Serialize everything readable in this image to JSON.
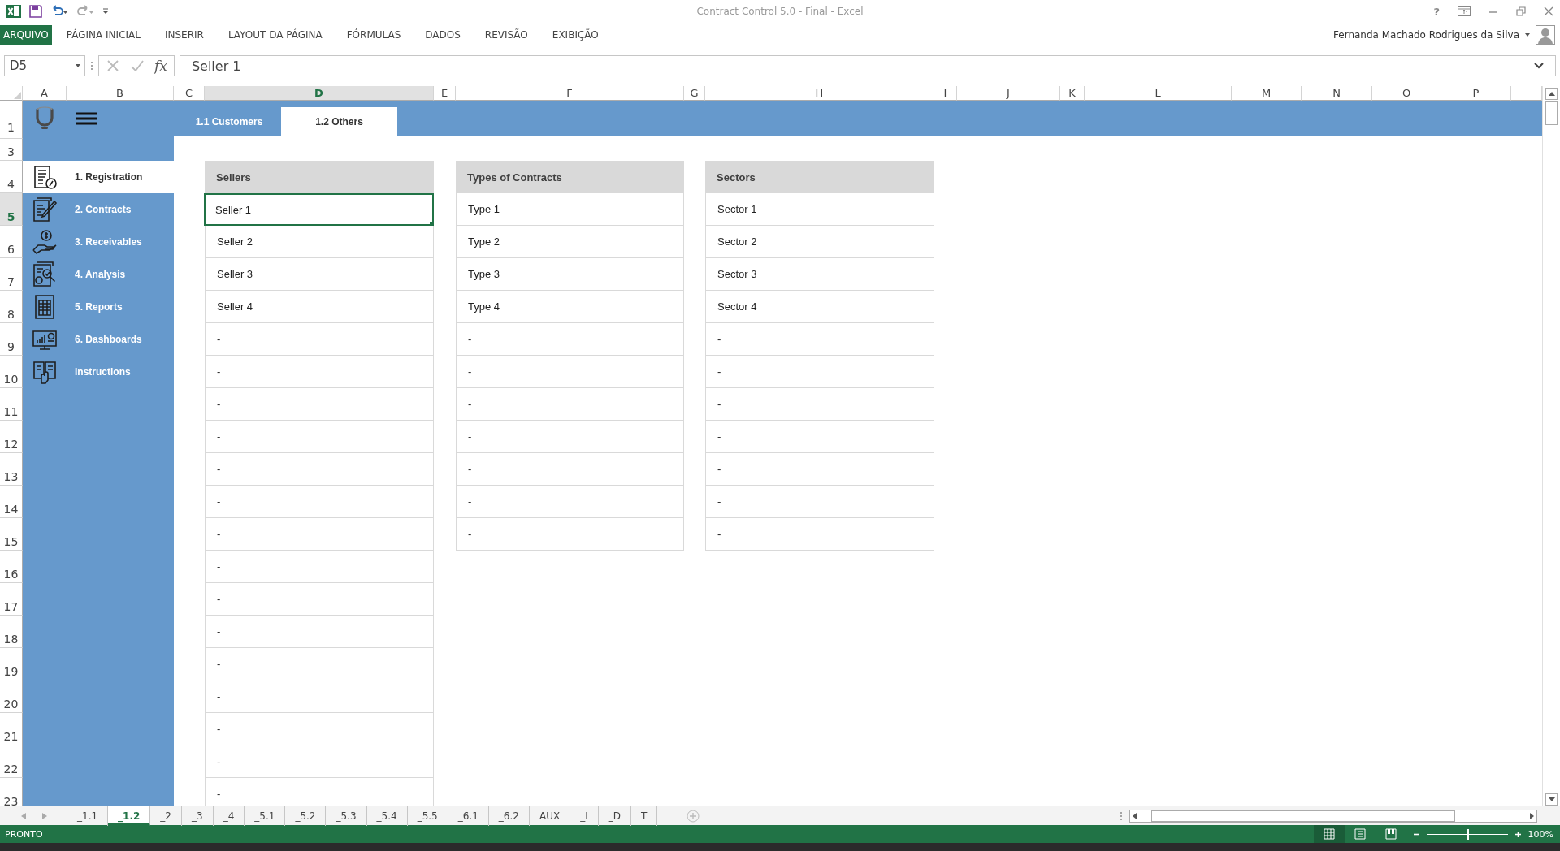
{
  "title_bar": {
    "title": "Contract Control 5.0 - Final - Excel",
    "help": "?"
  },
  "ribbon_tabs": [
    {
      "label": "ARQUIVO",
      "kind": "file"
    },
    {
      "label": "PÁGINA INICIAL",
      "kind": "tab"
    },
    {
      "label": "INSERIR",
      "kind": "tab"
    },
    {
      "label": "LAYOUT DA PÁGINA",
      "kind": "tab"
    },
    {
      "label": "FÓRMULAS",
      "kind": "tab"
    },
    {
      "label": "DADOS",
      "kind": "tab"
    },
    {
      "label": "REVISÃO",
      "kind": "tab"
    },
    {
      "label": "EXIBIÇÃO",
      "kind": "tab"
    }
  ],
  "user": {
    "name": "Fernanda Machado Rodrigues da Silva"
  },
  "formula_bar": {
    "name_box": "D5",
    "function_label": "fx",
    "value": "Seller 1"
  },
  "column_headers": [
    {
      "label": "A",
      "selected": false
    },
    {
      "label": "B",
      "selected": false
    },
    {
      "label": "C",
      "selected": false
    },
    {
      "label": "D",
      "selected": true
    },
    {
      "label": "E",
      "selected": false
    },
    {
      "label": "F",
      "selected": false
    },
    {
      "label": "G",
      "selected": false
    },
    {
      "label": "H",
      "selected": false
    },
    {
      "label": "I",
      "selected": false
    },
    {
      "label": "J",
      "selected": false
    },
    {
      "label": "K",
      "selected": false
    },
    {
      "label": "L",
      "selected": false
    },
    {
      "label": "M",
      "selected": false
    },
    {
      "label": "N",
      "selected": false
    },
    {
      "label": "O",
      "selected": false
    },
    {
      "label": "P",
      "selected": false
    }
  ],
  "row_headers": [
    {
      "label": "1",
      "selected": false
    },
    {
      "label": "3",
      "selected": false
    },
    {
      "label": "4",
      "selected": false
    },
    {
      "label": "5",
      "selected": true
    },
    {
      "label": "6",
      "selected": false
    },
    {
      "label": "7",
      "selected": false
    },
    {
      "label": "8",
      "selected": false
    },
    {
      "label": "9",
      "selected": false
    },
    {
      "label": "10",
      "selected": false
    },
    {
      "label": "11",
      "selected": false
    },
    {
      "label": "12",
      "selected": false
    },
    {
      "label": "13",
      "selected": false
    },
    {
      "label": "14",
      "selected": false
    },
    {
      "label": "15",
      "selected": false
    },
    {
      "label": "16",
      "selected": false
    },
    {
      "label": "17",
      "selected": false
    },
    {
      "label": "18",
      "selected": false
    },
    {
      "label": "19",
      "selected": false
    },
    {
      "label": "20",
      "selected": false
    },
    {
      "label": "21",
      "selected": false
    },
    {
      "label": "22",
      "selected": false
    },
    {
      "label": "23",
      "selected": false
    }
  ],
  "sidebar": {
    "items": [
      {
        "label": "1. Registration",
        "selected": true
      },
      {
        "label": "2. Contracts",
        "selected": false
      },
      {
        "label": "3. Receivables",
        "selected": false
      },
      {
        "label": "4. Analysis",
        "selected": false
      },
      {
        "label": "5. Reports",
        "selected": false
      },
      {
        "label": "6. Dashboards",
        "selected": false
      },
      {
        "label": "Instructions",
        "selected": false
      }
    ]
  },
  "page_tabs": [
    {
      "label": "1.1 Customers",
      "selected": false
    },
    {
      "label": "1.2 Others",
      "selected": true
    }
  ],
  "tables": [
    {
      "header": "Sellers",
      "rows": [
        {
          "text": "Seller 1",
          "selected": true
        },
        {
          "text": "Seller 2",
          "selected": false
        },
        {
          "text": "Seller 3",
          "selected": false
        },
        {
          "text": "Seller 4",
          "selected": false
        },
        {
          "text": "-",
          "selected": false
        },
        {
          "text": "-",
          "selected": false
        },
        {
          "text": "-",
          "selected": false
        },
        {
          "text": "-",
          "selected": false
        },
        {
          "text": "-",
          "selected": false
        },
        {
          "text": "-",
          "selected": false
        },
        {
          "text": "-",
          "selected": false
        },
        {
          "text": "-",
          "selected": false
        },
        {
          "text": "-",
          "selected": false
        },
        {
          "text": "-",
          "selected": false
        },
        {
          "text": "-",
          "selected": false
        },
        {
          "text": "-",
          "selected": false
        },
        {
          "text": "-",
          "selected": false
        },
        {
          "text": "-",
          "selected": false
        },
        {
          "text": "-",
          "selected": false
        }
      ]
    },
    {
      "header": "Types of Contracts",
      "rows": [
        {
          "text": "Type 1",
          "selected": false
        },
        {
          "text": "Type 2",
          "selected": false
        },
        {
          "text": "Type 3",
          "selected": false
        },
        {
          "text": "Type 4",
          "selected": false
        },
        {
          "text": "-",
          "selected": false
        },
        {
          "text": "-",
          "selected": false
        },
        {
          "text": "-",
          "selected": false
        },
        {
          "text": "-",
          "selected": false
        },
        {
          "text": "-",
          "selected": false
        },
        {
          "text": "-",
          "selected": false
        },
        {
          "text": "-",
          "selected": false
        }
      ]
    },
    {
      "header": "Sectors",
      "rows": [
        {
          "text": "Sector 1",
          "selected": false
        },
        {
          "text": "Sector 2",
          "selected": false
        },
        {
          "text": "Sector 3",
          "selected": false
        },
        {
          "text": "Sector 4",
          "selected": false
        },
        {
          "text": "-",
          "selected": false
        },
        {
          "text": "-",
          "selected": false
        },
        {
          "text": "-",
          "selected": false
        },
        {
          "text": "-",
          "selected": false
        },
        {
          "text": "-",
          "selected": false
        },
        {
          "text": "-",
          "selected": false
        },
        {
          "text": "-",
          "selected": false
        }
      ]
    }
  ],
  "sheet_tabs": [
    {
      "label": "_1.1",
      "selected": false
    },
    {
      "label": "_1.2",
      "selected": true
    },
    {
      "label": "_2",
      "selected": false
    },
    {
      "label": "_3",
      "selected": false
    },
    {
      "label": "_4",
      "selected": false
    },
    {
      "label": "_5.1",
      "selected": false
    },
    {
      "label": "_5.2",
      "selected": false
    },
    {
      "label": "_5.3",
      "selected": false
    },
    {
      "label": "_5.4",
      "selected": false
    },
    {
      "label": "_5.5",
      "selected": false
    },
    {
      "label": "_6.1",
      "selected": false
    },
    {
      "label": "_6.2",
      "selected": false
    },
    {
      "label": "AUX",
      "selected": false
    },
    {
      "label": "_I",
      "selected": false
    },
    {
      "label": "_D",
      "selected": false
    },
    {
      "label": "T",
      "selected": false
    }
  ],
  "status_bar": {
    "status": "PRONTO",
    "zoom": "100%",
    "level": 0.5
  }
}
